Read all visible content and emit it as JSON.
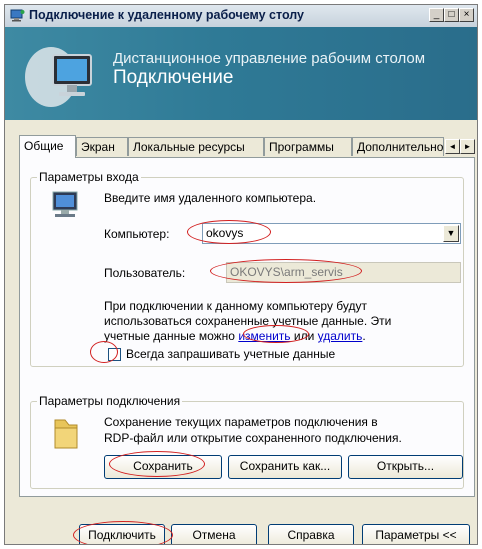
{
  "window": {
    "title": "Подключение к удаленному рабочему столу",
    "minimize_glyph": "_",
    "maximize_glyph": "□",
    "close_glyph": "×"
  },
  "banner": {
    "subtitle": "Дистанционное управление рабочим столом",
    "title": "Подключение"
  },
  "tabs": [
    {
      "label": "Общие",
      "active": true
    },
    {
      "label": "Экран",
      "active": false
    },
    {
      "label": "Локальные ресурсы",
      "active": false
    },
    {
      "label": "Программы",
      "active": false
    },
    {
      "label": "Дополнительно",
      "active": false
    }
  ],
  "tab_scroll": {
    "left": "◄",
    "right": "►"
  },
  "login_group": {
    "legend": "Параметры входа",
    "prompt": "Введите имя удаленного компьютера.",
    "computer_label": "Компьютер:",
    "computer_value": "okovys",
    "dropdown_glyph": "▼",
    "user_label": "Пользователь:",
    "user_value": "OKOVYS\\arm_servis",
    "info_line1": "При подключении к данному компьютеру будут",
    "info_line2": "использоваться сохраненные учетные данные. Эти",
    "info_line3_prefix": "учетные данные можно",
    "info_link_change": "изменить",
    "info_or": "или",
    "info_link_delete": "удалить",
    "info_period": ".",
    "always_ask_label": "Всегда запрашивать учетные данные",
    "always_ask_checked": false
  },
  "connection_group": {
    "legend": "Параметры подключения",
    "desc_line1": "Сохранение текущих параметров подключения в",
    "desc_line2": "RDP-файл или открытие сохраненного подключения.",
    "save_button": "Сохранить",
    "save_as_button": "Сохранить как...",
    "open_button": "Открыть..."
  },
  "footer": {
    "connect_button": "Подключить",
    "cancel_button": "Отмена",
    "help_button": "Справка",
    "options_button": "Параметры <<"
  },
  "colors": {
    "banner": "#2f7a96",
    "highlight": "#d22020",
    "link": "#0000cc"
  }
}
